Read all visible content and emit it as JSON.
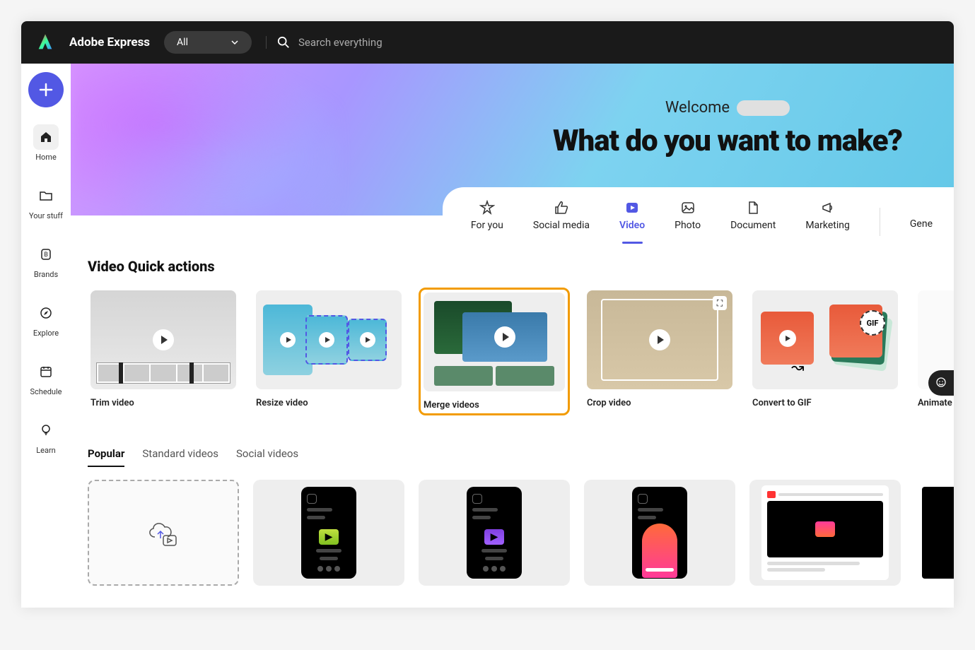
{
  "brand": "Adobe Express",
  "category_select": {
    "label": "All"
  },
  "search": {
    "placeholder": "Search everything"
  },
  "sidebar": {
    "items": [
      {
        "id": "home",
        "label": "Home",
        "active": true
      },
      {
        "id": "your-stuff",
        "label": "Your stuff"
      },
      {
        "id": "brands",
        "label": "Brands"
      },
      {
        "id": "explore",
        "label": "Explore"
      },
      {
        "id": "schedule",
        "label": "Schedule"
      },
      {
        "id": "learn",
        "label": "Learn"
      }
    ]
  },
  "hero": {
    "welcome": "Welcome",
    "title": "What do you want to make?"
  },
  "tabs": [
    {
      "id": "for-you",
      "label": "For you"
    },
    {
      "id": "social-media",
      "label": "Social media"
    },
    {
      "id": "video",
      "label": "Video",
      "active": true
    },
    {
      "id": "photo",
      "label": "Photo"
    },
    {
      "id": "document",
      "label": "Document"
    },
    {
      "id": "marketing",
      "label": "Marketing"
    },
    {
      "id": "generate",
      "label": "Gene"
    }
  ],
  "quick_actions": {
    "title": "Video Quick actions",
    "items": [
      {
        "id": "trim",
        "label": "Trim video"
      },
      {
        "id": "resize",
        "label": "Resize video"
      },
      {
        "id": "merge",
        "label": "Merge videos",
        "highlighted": true
      },
      {
        "id": "crop",
        "label": "Crop video"
      },
      {
        "id": "gif",
        "label": "Convert to GIF"
      },
      {
        "id": "animate",
        "label": "Animate fro"
      }
    ],
    "gif_badge": "GIF"
  },
  "subtabs": [
    {
      "id": "popular",
      "label": "Popular",
      "active": true
    },
    {
      "id": "standard",
      "label": "Standard videos"
    },
    {
      "id": "social",
      "label": "Social videos"
    }
  ]
}
